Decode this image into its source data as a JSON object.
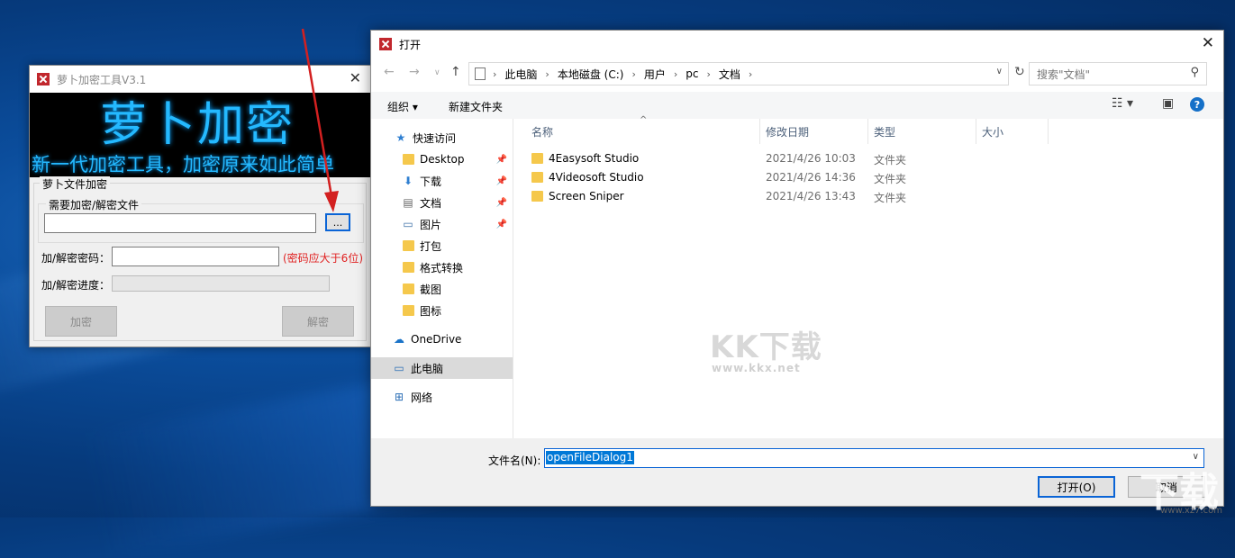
{
  "colors": {
    "accent": "#0078d7",
    "banner_text": "#24b9ff",
    "hint_red": "#e02020",
    "app_logo": "#c1272d"
  },
  "app_window": {
    "title": "萝卜加密工具V3.1",
    "banner_big": "萝卜加密",
    "banner_small": "新一代加密工具，加密原来如此简单",
    "group_title": "萝卜文件加密",
    "file_group_title": "需要加密/解密文件",
    "file_input_value": "",
    "browse_label": "...",
    "password_label": "加/解密密码：",
    "password_value": "",
    "password_hint": "(密码应大于6位)",
    "progress_label": "加/解密进度：",
    "progress_value": 0,
    "encrypt_label": "加密",
    "decrypt_label": "解密",
    "close_icon": "✕"
  },
  "dialog": {
    "title": "打开",
    "close_icon": "✕",
    "breadcrumb": [
      "此电脑",
      "本地磁盘 (C:)",
      "用户",
      "pc",
      "文档"
    ],
    "search_placeholder": "搜索\"文档\"",
    "toolbar": {
      "organize": "组织 ▾",
      "new_folder": "新建文件夹"
    },
    "nav_items": [
      {
        "label": "快速访问",
        "icon": "star-icon"
      },
      {
        "label": "Desktop",
        "icon": "folder-icon",
        "pinned": true
      },
      {
        "label": "下载",
        "icon": "download-icon",
        "pinned": true
      },
      {
        "label": "文档",
        "icon": "document-icon",
        "pinned": true
      },
      {
        "label": "图片",
        "icon": "picture-icon",
        "pinned": true
      },
      {
        "label": "打包",
        "icon": "folder-icon"
      },
      {
        "label": "格式转换",
        "icon": "folder-icon"
      },
      {
        "label": "截图",
        "icon": "folder-icon"
      },
      {
        "label": "图标",
        "icon": "folder-icon"
      },
      {
        "label": "OneDrive",
        "icon": "cloud-icon"
      },
      {
        "label": "此电脑",
        "icon": "computer-icon",
        "selected": true
      },
      {
        "label": "网络",
        "icon": "network-icon"
      }
    ],
    "columns": [
      "名称",
      "修改日期",
      "类型",
      "大小"
    ],
    "files": [
      {
        "name": "4Easysoft Studio",
        "date": "2021/4/26 10:03",
        "type": "文件夹",
        "size": ""
      },
      {
        "name": "4Videosoft Studio",
        "date": "2021/4/26 14:36",
        "type": "文件夹",
        "size": ""
      },
      {
        "name": "Screen Sniper",
        "date": "2021/4/26 13:43",
        "type": "文件夹",
        "size": ""
      }
    ],
    "watermark_main": "KK下载",
    "watermark_sub": "www.kkx.net",
    "filename_label": "文件名(N):",
    "filename_value": "openFileDialog1",
    "open_button": "打开(O)",
    "cancel_button": "取消"
  },
  "corner_watermark": {
    "big": "下载",
    "url": "www.xz7.com"
  }
}
